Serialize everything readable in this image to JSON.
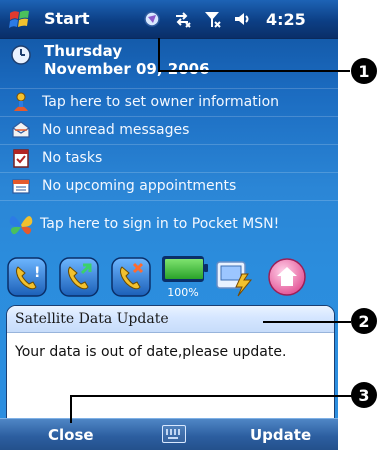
{
  "title_bar": {
    "start_label": "Start",
    "time": "4:25",
    "icons": [
      "sync-icon",
      "connectivity-icon",
      "signal-icon",
      "volume-icon"
    ]
  },
  "today": {
    "day": "Thursday",
    "date": "November 09, 2006",
    "rows": [
      {
        "icon": "owner-icon",
        "text": "Tap here to set owner information"
      },
      {
        "icon": "inbox-icon",
        "text": "No unread messages"
      },
      {
        "icon": "tasks-icon",
        "text": "No tasks"
      },
      {
        "icon": "calendar-icon",
        "text": "No upcoming appointments"
      },
      {
        "icon": "msn-butterfly-icon",
        "text": "Tap here to sign in to Pocket MSN!"
      }
    ]
  },
  "quick_launch": {
    "buttons": [
      "phone-call-icon",
      "phone-answer-icon",
      "phone-hangup-icon",
      "battery-icon",
      "update-icon",
      "home-icon"
    ],
    "battery_percent_label": "100%",
    "battery_level": 1.0
  },
  "dialog": {
    "title": "Satellite Data Update",
    "message": "Your data is out of date,please update."
  },
  "softkeys": {
    "left": "Close",
    "right": "Update"
  },
  "callouts": [
    "1",
    "2",
    "3"
  ],
  "colors": {
    "title_bar": "#0c3f85",
    "today_bg": "#2b86d6",
    "dialog_bg": "#ffffff",
    "softbar": "#2c5ea0"
  }
}
